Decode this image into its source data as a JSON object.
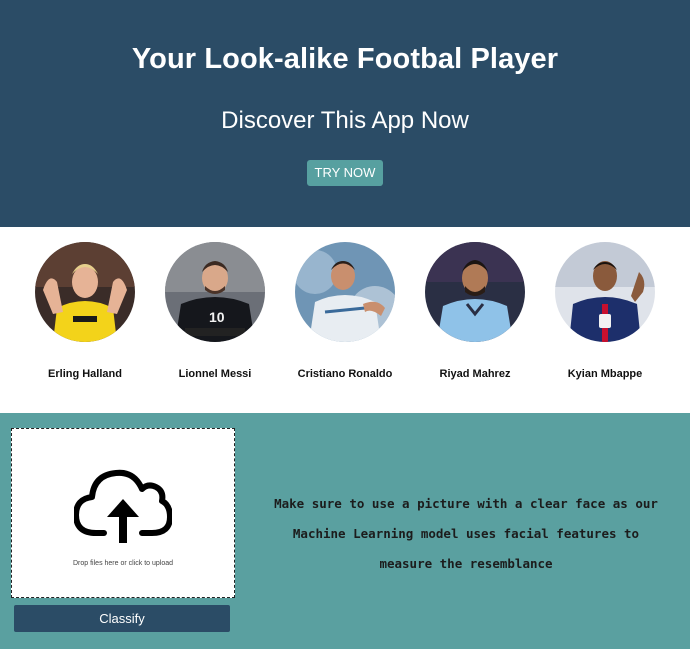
{
  "hero": {
    "title": "Your Look-alike Footbal Player",
    "subtitle": "Discover This App Now",
    "cta_label": "TRY NOW"
  },
  "players": [
    {
      "name": "Erling Halland",
      "kit_color": "#f3d31a",
      "accent_color": "#1a1a1a"
    },
    {
      "name": "Lionnel Messi",
      "kit_color": "#15171c",
      "accent_color": "#f2f2f2"
    },
    {
      "name": "Cristiano Ronaldo",
      "kit_color": "#e8edf2",
      "accent_color": "#3a6a9a"
    },
    {
      "name": "Riyad Mahrez",
      "kit_color": "#8fc2e8",
      "accent_color": "#2a2f44"
    },
    {
      "name": "Kyian Mbappe",
      "kit_color": "#1d2f6b",
      "accent_color": "#c8102e"
    }
  ],
  "upload": {
    "dropzone_text": "Drop files here or click to upload",
    "icon": "cloud-upload-icon",
    "classify_label": "Classify"
  },
  "info": {
    "lines": [
      "Make sure to use a picture with a clear face as our",
      "Machine Learning model uses facial features to",
      "measure the resemblance"
    ]
  },
  "colors": {
    "hero_bg": "#2b4c66",
    "teal": "#57a0a0",
    "section_bg": "#5aa0a0"
  }
}
